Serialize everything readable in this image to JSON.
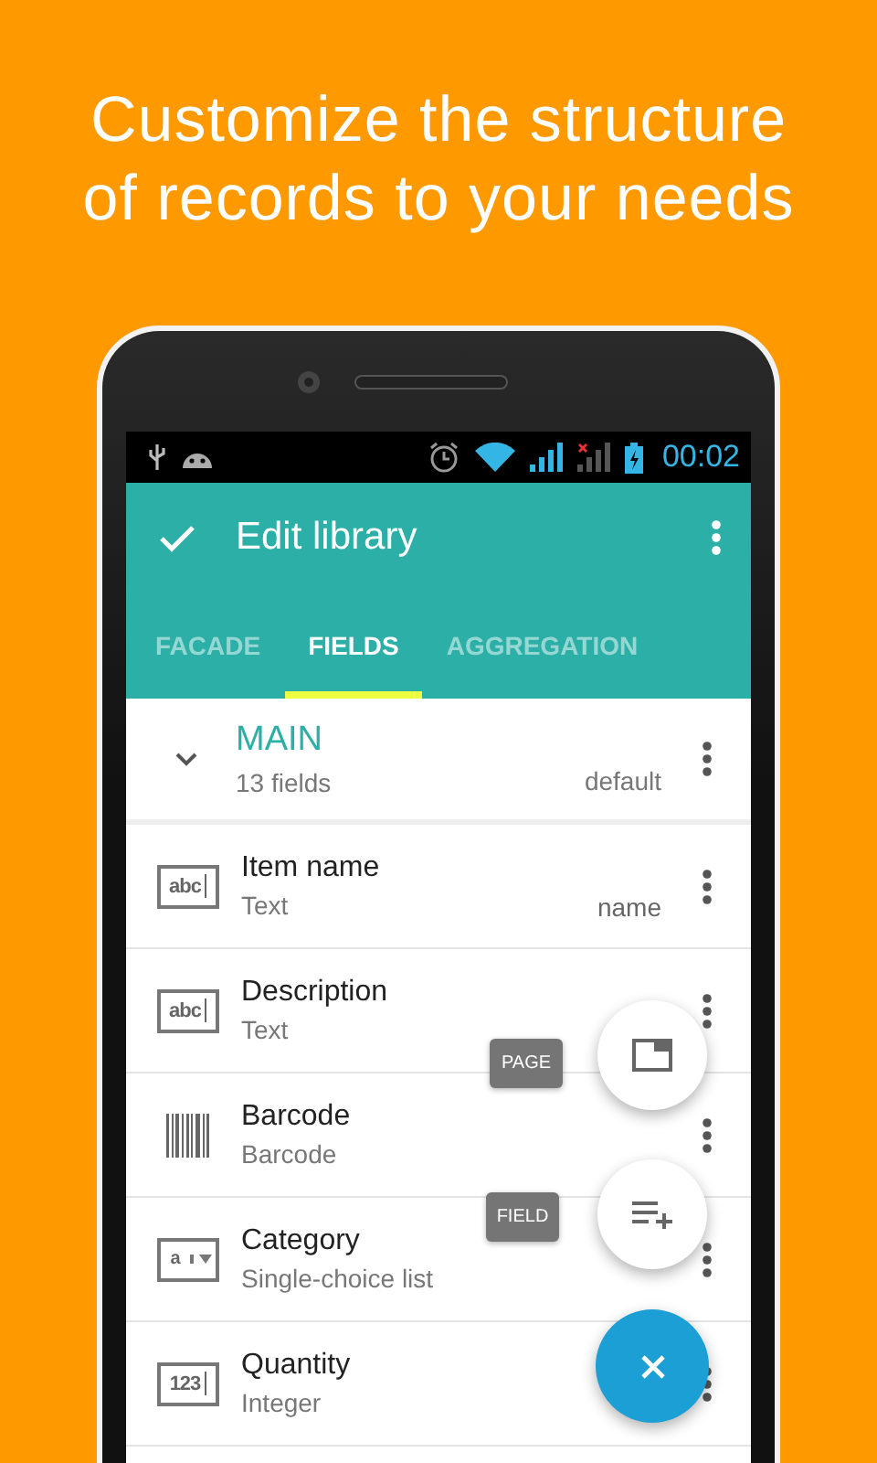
{
  "headline": "Customize the structure\nof records to your needs",
  "status_bar": {
    "time": "00:02"
  },
  "toolbar": {
    "title": "Edit library"
  },
  "tabs": [
    {
      "label": "FACADE",
      "selected": false
    },
    {
      "label": "FIELDS",
      "selected": true
    },
    {
      "label": "AGGREGATION",
      "selected": false
    }
  ],
  "section": {
    "title": "MAIN",
    "count": "13 fields",
    "tag": "default",
    "expanded": true
  },
  "fields": [
    {
      "kind": "text",
      "icon_text": "abc",
      "name": "Item name",
      "type": "Text",
      "tag": "name"
    },
    {
      "kind": "text",
      "icon_text": "abc",
      "name": "Description",
      "type": "Text"
    },
    {
      "kind": "barcode",
      "name": "Barcode",
      "type": "Barcode"
    },
    {
      "kind": "list",
      "icon_text": "a",
      "name": "Category",
      "type": "Single-choice list"
    },
    {
      "kind": "text",
      "icon_text": "123",
      "name": "Quantity",
      "type": "Integer"
    }
  ],
  "fab_menu": [
    {
      "kind": "page",
      "label": "PAGE"
    },
    {
      "kind": "field",
      "label": "FIELD"
    }
  ]
}
